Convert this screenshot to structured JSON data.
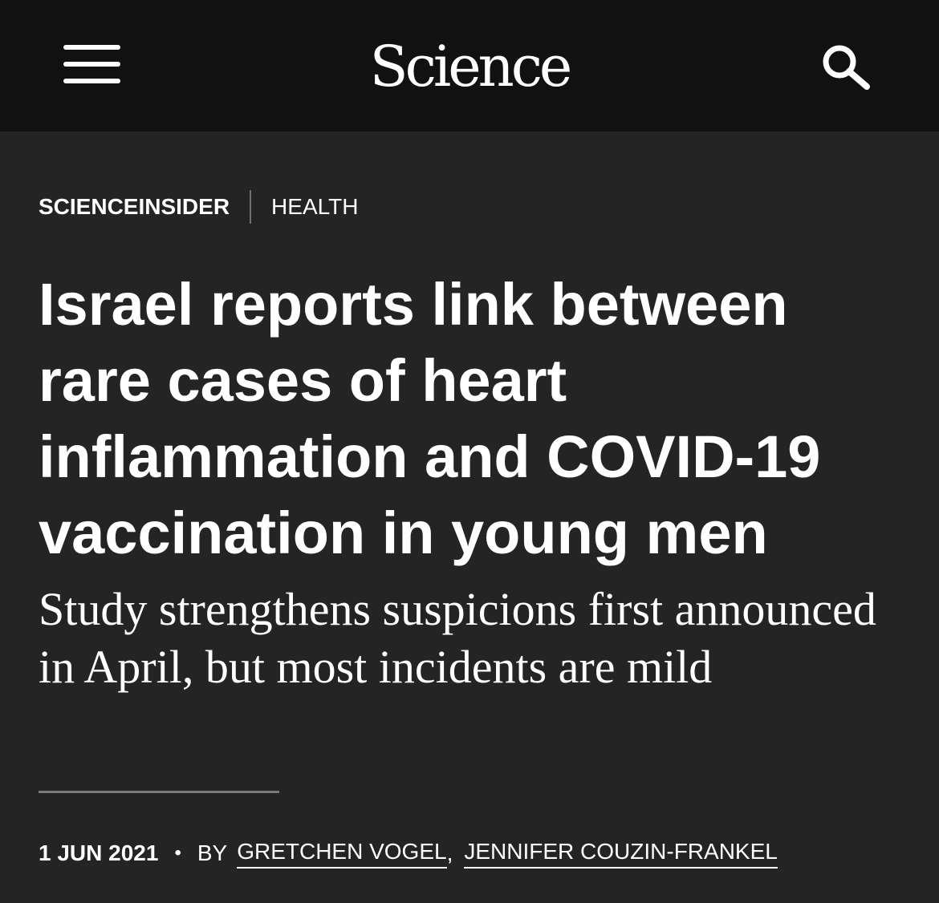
{
  "header": {
    "logo": "Science",
    "menu_icon": "hamburger-menu-icon",
    "search_icon": "search-icon"
  },
  "article": {
    "section_primary": "SCIENCEINSIDER",
    "section_secondary": "HEALTH",
    "headline": "Israel reports link between rare cases of heart inflammation and COVID-19 vaccination in young men",
    "dek": "Study strengthens suspicions first announced in April, but most incidents are mild",
    "date": "1 JUN 2021",
    "byline_separator": "•",
    "by_label": "BY",
    "authors": [
      "GRETCHEN VOGEL",
      "JENNIFER COUZIN-FRANKEL"
    ],
    "author_separator": ","
  },
  "colors": {
    "header_bg": "#111111",
    "page_bg": "#242424",
    "text": "#ffffff"
  }
}
